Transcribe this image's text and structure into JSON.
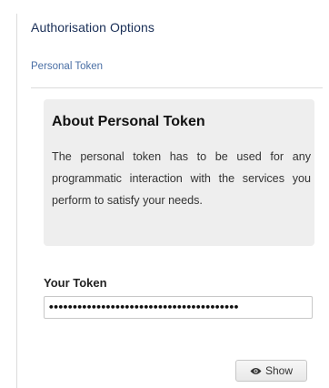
{
  "section": {
    "title": "Authorisation Options",
    "subtitle": "Personal Token"
  },
  "about": {
    "heading": "About Personal Token",
    "text": "The personal token has to be used for any programmatic interaction with the services you perform to satisfy your needs."
  },
  "token": {
    "label": "Your Token",
    "value": "••••••••••••••••••••••••••••••••••••••••"
  },
  "actions": {
    "show_label": "Show",
    "show_icon": "eye-icon"
  },
  "colors": {
    "title": "#1a2f57",
    "subtitle": "#4a6fa5",
    "panel_bg": "#eeeeee"
  }
}
